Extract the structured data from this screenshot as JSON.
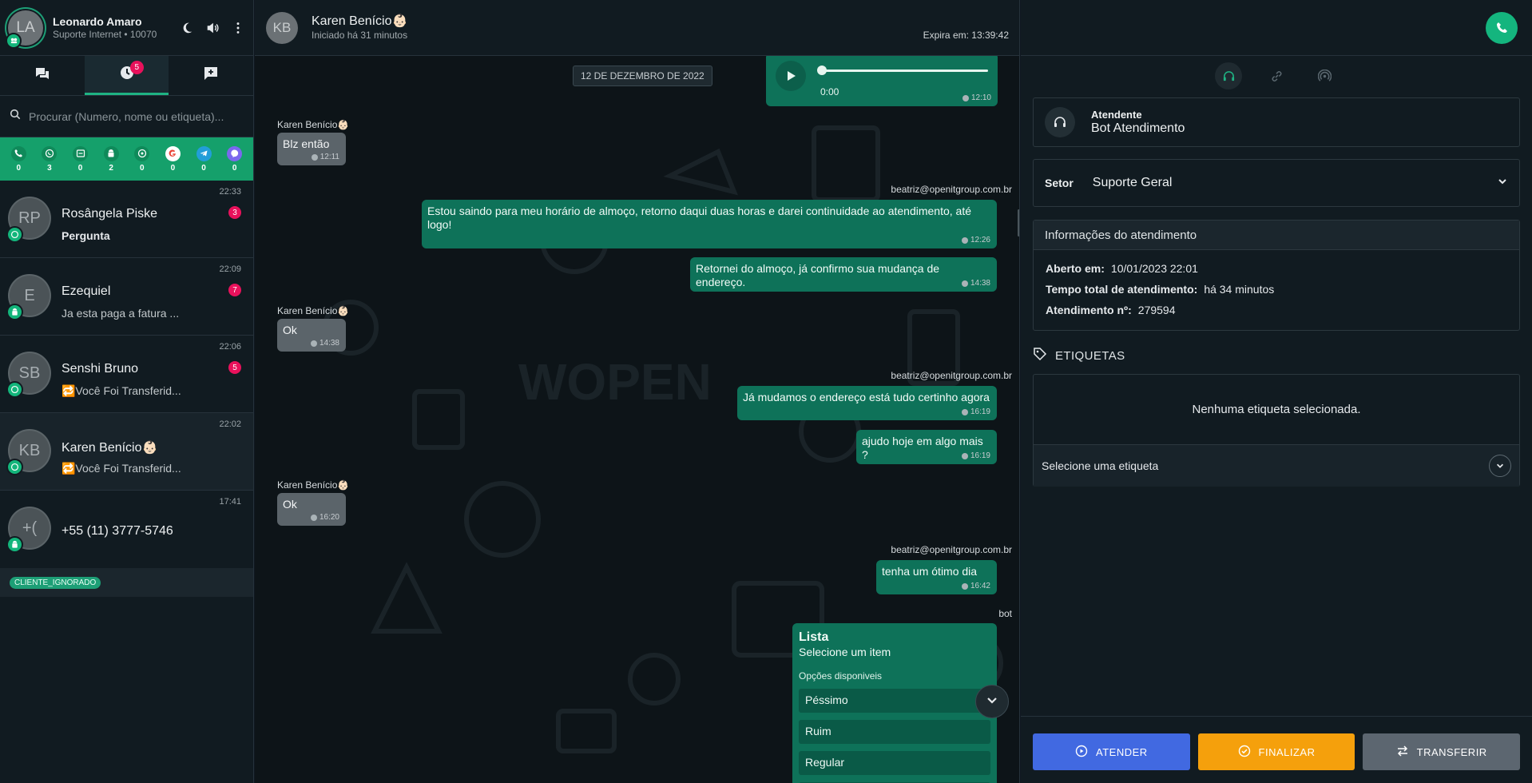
{
  "user": {
    "initials": "LA",
    "name": "Leonardo Amaro",
    "subtitle": "Suporte Internet • 10070"
  },
  "left_tabs": [
    {
      "icon": "chat-bubbles-icon"
    },
    {
      "icon": "clock-icon",
      "badge": "5"
    },
    {
      "icon": "new-message-icon"
    }
  ],
  "search": {
    "placeholder": "Procurar (Numero, nome ou etiqueta)..."
  },
  "channels": [
    {
      "icon": "phone-icon",
      "count": "0",
      "color": "#0f8a5a"
    },
    {
      "icon": "whatsapp-icon",
      "count": "3",
      "color": "#0f8a5a"
    },
    {
      "icon": "whatsapp-business-icon",
      "count": "0",
      "color": "#0f8a5a"
    },
    {
      "icon": "android-icon",
      "count": "2",
      "color": "#0f8a5a"
    },
    {
      "icon": "whatsapp-alt-icon",
      "count": "0",
      "color": "#0f8a5a"
    },
    {
      "icon": "google-icon",
      "count": "0",
      "color": "#ffffff"
    },
    {
      "icon": "telegram-icon",
      "count": "0",
      "color": "#229ed9"
    },
    {
      "icon": "messenger-icon",
      "count": "0",
      "color": "#7b68ee"
    }
  ],
  "contacts": [
    {
      "initials": "RP",
      "name": "Rosângela Piske",
      "message": "Pergunta",
      "time": "22:33",
      "unread": "3"
    },
    {
      "initials": "E",
      "name": "Ezequiel",
      "message": "Ja esta paga a fatura ...",
      "time": "22:09",
      "unread": "7"
    },
    {
      "initials": "SB",
      "name": "Senshi Bruno",
      "message": "🔁Você Foi Transferid...",
      "time": "22:06",
      "unread": "5"
    },
    {
      "initials": "KB",
      "name": "Karen Benício👶🏻",
      "message": "🔁Você Foi Transferid...",
      "time": "22:02",
      "unread": ""
    },
    {
      "initials": "+(",
      "name": "+55 (11) 3777-5746",
      "message": "",
      "time": "17:41",
      "unread": ""
    }
  ],
  "ignored_tag": "CLIENTE_IGNORADO",
  "chat": {
    "initials": "KB",
    "name": "Karen Benício👶🏻",
    "subtitle": "Iniciado há 31 minutos",
    "expires": "Expira em: 13:39:42",
    "date_separator": "12 DE DEZEMBRO DE 2022",
    "audio": {
      "duration": "0:00",
      "time": "12:10"
    },
    "messages": [
      {
        "sender": "Karen Benício👶🏻",
        "text": "Blz então",
        "time": "12:11"
      },
      {
        "sender": "beatriz@openitgroup.com.br",
        "text": "Estou saindo para meu horário de almoço, retorno daqui duas horas e darei continuidade ao atendimento, até logo!",
        "time": "12:26"
      },
      {
        "sender": "",
        "text": "Retornei do almoço, já confirmo sua mudança de endereço.",
        "time": "14:38"
      },
      {
        "sender": "Karen Benício👶🏻",
        "text": "Ok",
        "time": "14:38"
      },
      {
        "sender": "beatriz@openitgroup.com.br",
        "text": "Já mudamos o endereço está tudo certinho agora",
        "time": "16:19"
      },
      {
        "sender": "",
        "text": "ajudo hoje em algo mais ?",
        "time": "16:19"
      },
      {
        "sender": "Karen Benício👶🏻",
        "text": "Ok",
        "time": "16:20"
      },
      {
        "sender": "beatriz@openitgroup.com.br",
        "text": "tenha um ótimo dia",
        "time": "16:42"
      }
    ],
    "list_message": {
      "sender": "bot",
      "title": "Lista",
      "subtitle": "Selecione um item",
      "options_label": "Opções disponiveis",
      "options": [
        "Péssimo",
        "Ruim",
        "Regular"
      ]
    }
  },
  "panel": {
    "atendente_label": "Atendente",
    "atendente_value": "Bot Atendimento",
    "setor_label": "Setor",
    "setor_value": "Suporte Geral",
    "info_title": "Informações do atendimento",
    "info_rows": [
      {
        "label": "Aberto em:",
        "value": "10/01/2023 22:01"
      },
      {
        "label": "Tempo total de atendimento:",
        "value": "há 34 minutos"
      },
      {
        "label": "Atendimento nº:",
        "value": "279594"
      }
    ],
    "tags_title": "ETIQUETAS",
    "tags_empty": "Nenhuma etiqueta selecionada.",
    "tags_select": "Selecione uma etiqueta",
    "buttons": {
      "atender": "ATENDER",
      "finalizar": "FINALIZAR",
      "transferir": "TRANSFERIR"
    },
    "colors": {
      "atender": "#4169e1",
      "finalizar": "#f5a00c",
      "transferir": "#5c6670",
      "accent": "#14b57e"
    }
  }
}
